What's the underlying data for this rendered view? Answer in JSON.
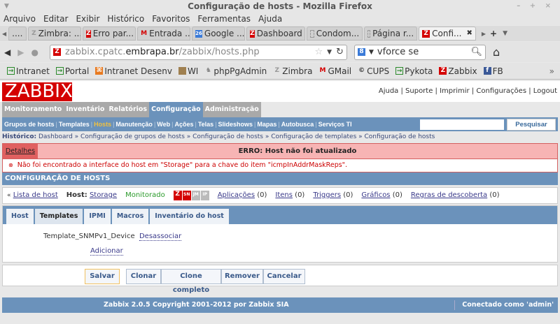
{
  "window": {
    "title": "Configuração de hosts - Mozilla Firefox",
    "controls": "– + ×"
  },
  "menubar": [
    "Arquivo",
    "Editar",
    "Exibir",
    "Histórico",
    "Favoritos",
    "Ferramentas",
    "Ajuda"
  ],
  "tabs": [
    {
      "label": "....",
      "icon": ""
    },
    {
      "label": "Zimbra: ...",
      "icon": "Z"
    },
    {
      "label": "Erro par...",
      "icon": "Z"
    },
    {
      "label": "Entrada ...",
      "icon": "M"
    },
    {
      "label": "Google ...",
      "icon": "26"
    },
    {
      "label": "Dashboard",
      "icon": "Z"
    },
    {
      "label": "Condom...",
      "icon": ""
    },
    {
      "label": "Página r...",
      "icon": ""
    },
    {
      "label": "Confi...",
      "icon": "Z"
    }
  ],
  "tab_close": "✖",
  "url": {
    "pre": "zabbix.cpatc.",
    "domain": "embrapa.br",
    "post": "/zabbix/hosts.php"
  },
  "search_value": "vforce se",
  "bookmarks": [
    "Intranet",
    "Portal",
    "Intranet Desenv",
    "WI",
    "phpPgAdmin",
    "Zimbra",
    "GMail",
    "CUPS",
    "Pykota",
    "Zabbix",
    "FB"
  ],
  "bookmarks_more": "»",
  "zabbix": {
    "logo": "ZABBIX",
    "toplinks": "Ajuda | Suporte | Imprimir | Configurações | Logout",
    "main_menu": [
      "Monitoramento",
      "Inventário",
      "Relatórios",
      "Configuração",
      "Administração"
    ],
    "sub_menu": [
      "Grupos de hosts",
      "Templates",
      "Hosts",
      "Manutenção",
      "Web",
      "Ações",
      "Telas",
      "Slideshows",
      "Mapas",
      "Autobusca",
      "Serviços TI"
    ],
    "search_button": "Pesquisar",
    "history_label": "Histórico:",
    "history": "Dashboard » Configuração de grupos de hosts » Configuração de hosts » Configuração de templates » Configuração de hosts",
    "error_details": "Detalhes",
    "error_title": "ERRO: Host não foi atualizado",
    "error_message": "Não foi encontrado a interface do host em \"Storage\" para a chave do item \"icmpInAddrMaskReps\".",
    "section_title": "CONFIGURAÇÃO DE HOSTS",
    "host_list_link": "Lista de host",
    "host_label": "Host:",
    "host_name": "Storage",
    "status": "Monitorado",
    "links": [
      {
        "label": "Aplicações",
        "count": "(0)"
      },
      {
        "label": "Itens",
        "count": "(0)"
      },
      {
        "label": "Triggers",
        "count": "(0)"
      },
      {
        "label": "Gráficos",
        "count": "(0)"
      },
      {
        "label": "Regras de descoberta",
        "count": "(0)"
      }
    ],
    "form_tabs": [
      "Host",
      "Templates",
      "IPMI",
      "Macros",
      "Inventário do host"
    ],
    "template_name": "Template_SNMPv1_Device",
    "unlink": "Desassociar",
    "add": "Adicionar",
    "buttons": {
      "save": "Salvar",
      "clone": "Clonar",
      "full_clone": "Clone completo",
      "delete": "Remover",
      "cancel": "Cancelar"
    },
    "footer": "Zabbix 2.0.5 Copyright 2001-2012 por Zabbix SIA",
    "connected": "Conectado como 'admin'"
  }
}
